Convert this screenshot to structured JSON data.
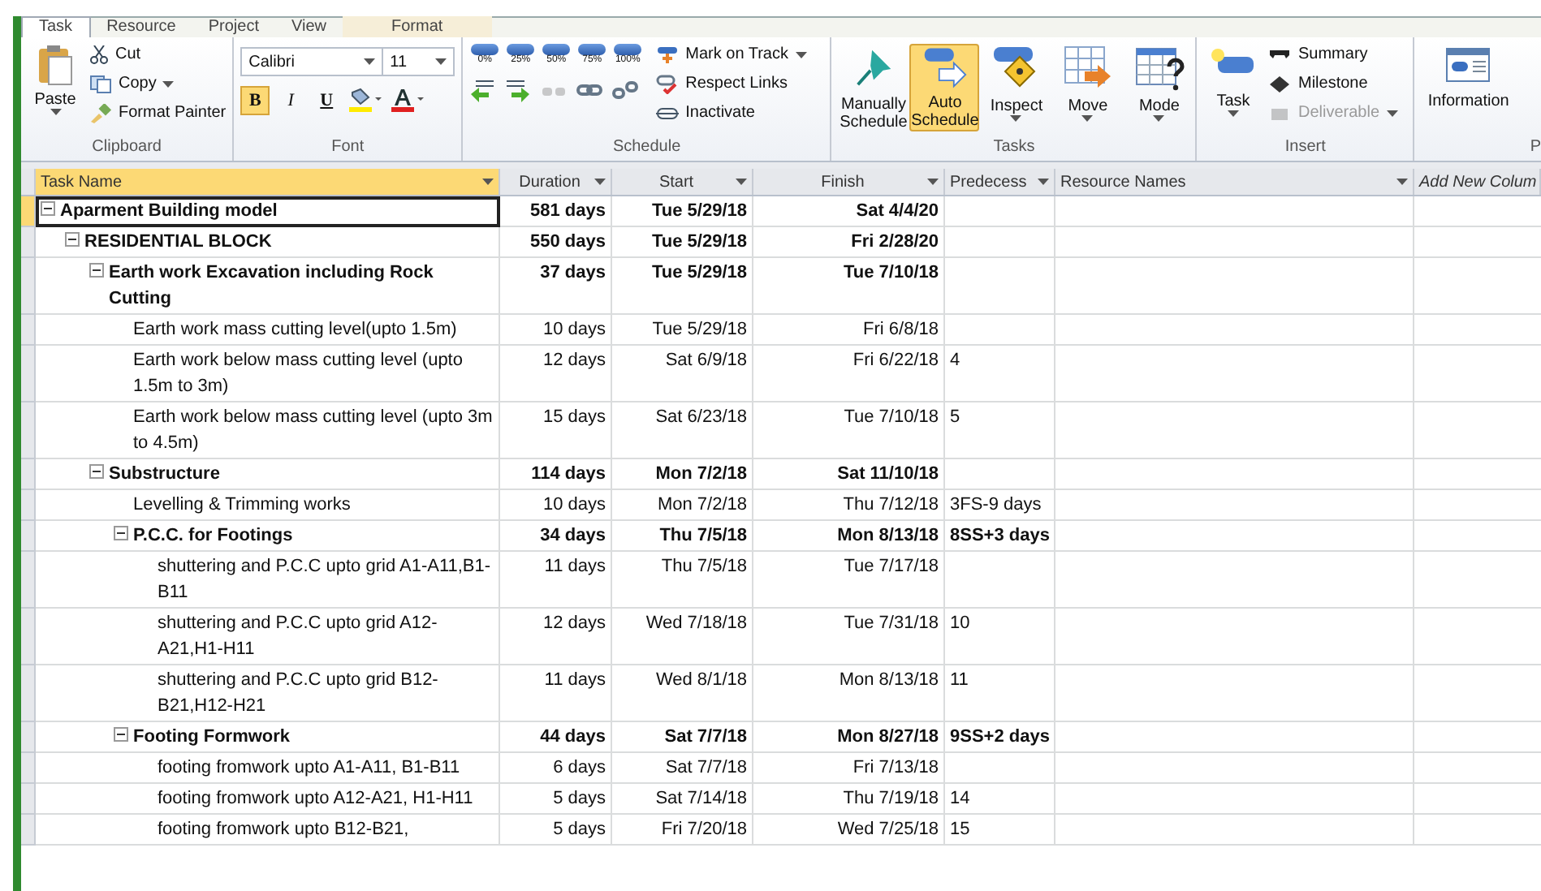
{
  "tabs": [
    {
      "label": "Task",
      "selected": true
    },
    {
      "label": "Resource",
      "selected": false
    },
    {
      "label": "Project",
      "selected": false
    },
    {
      "label": "View",
      "selected": false
    },
    {
      "label": "Format",
      "selected": false
    }
  ],
  "clipboard": {
    "paste": "Paste",
    "cut": "Cut",
    "copy": "Copy",
    "format_painter": "Format Painter",
    "label": "Clipboard"
  },
  "font": {
    "name": "Calibri",
    "size": "11",
    "styles": [
      {
        "label": "B",
        "selected": true
      },
      {
        "label": "I",
        "selected": false
      },
      {
        "label": "U",
        "selected": false
      }
    ],
    "label": "Font"
  },
  "schedule": {
    "percent_buttons": [
      "0%",
      "25%",
      "50%",
      "75%",
      "100%"
    ],
    "actions": [
      "Mark on Track",
      "Respect Links",
      "Inactivate"
    ],
    "label": "Schedule"
  },
  "tasks": {
    "buttons": [
      {
        "label": "Manually Schedule",
        "kind": "pin",
        "selected": false
      },
      {
        "label": "Auto Schedule",
        "kind": "auto",
        "selected": true
      },
      {
        "label": "Inspect",
        "kind": "inspect",
        "selected": false
      },
      {
        "label": "Move",
        "kind": "move",
        "selected": false
      },
      {
        "label": "Mode",
        "kind": "mode",
        "selected": false
      }
    ],
    "label": "Tasks"
  },
  "insert": {
    "task": "Task",
    "items": [
      {
        "label": "Summary",
        "disabled": false
      },
      {
        "label": "Milestone",
        "disabled": false
      },
      {
        "label": "Deliverable",
        "disabled": true
      }
    ],
    "label": "Insert"
  },
  "properties": {
    "information": "Information",
    "label": "P"
  },
  "table": {
    "columns": [
      "Task Name",
      "Duration",
      "Start",
      "Finish",
      "Predecess",
      "Resource Names",
      "Add New Colum"
    ],
    "rows": [
      {
        "name": "Aparment Building model",
        "duration": "581 days",
        "start": "Tue 5/29/18",
        "finish": "Sat 4/4/20",
        "selected": true,
        "expanded": true,
        "children": [
          {
            "name": "RESIDENTIAL BLOCK",
            "duration": "550 days",
            "start": "Tue 5/29/18",
            "finish": "Fri 2/28/20",
            "selected": false,
            "expanded": true,
            "children": [
              {
                "name": "Earth work Excavation including Rock Cutting",
                "duration": "37 days",
                "start": "Tue 5/29/18",
                "finish": "Tue 7/10/18",
                "selected": false,
                "expanded": true,
                "children": [
                  {
                    "name": "Earth work mass cutting level(upto 1.5m)",
                    "duration": "10 days",
                    "start": "Tue 5/29/18",
                    "finish": "Fri 6/8/18",
                    "selected": false
                  },
                  {
                    "name": "Earth work below mass cutting level (upto 1.5m to 3m)",
                    "duration": "12 days",
                    "start": "Sat 6/9/18",
                    "finish": "Fri 6/22/18",
                    "predecessors": "4",
                    "selected": false
                  },
                  {
                    "name": "Earth work below mass cutting level (upto 3m to 4.5m)",
                    "duration": "15 days",
                    "start": "Sat 6/23/18",
                    "finish": "Tue 7/10/18",
                    "predecessors": "5",
                    "selected": false
                  }
                ]
              },
              {
                "name": "Substructure",
                "duration": "114 days",
                "start": "Mon 7/2/18",
                "finish": "Sat 11/10/18",
                "selected": false,
                "expanded": true,
                "children": [
                  {
                    "name": "Levelling & Trimming works",
                    "duration": "10 days",
                    "start": "Mon 7/2/18",
                    "finish": "Thu 7/12/18",
                    "predecessors": "3FS-9 days",
                    "selected": false
                  },
                  {
                    "name": "P.C.C. for Footings",
                    "duration": "34 days",
                    "start": "Thu 7/5/18",
                    "finish": "Mon 8/13/18",
                    "predecessors": "8SS+3 days",
                    "selected": false,
                    "expanded": true,
                    "children": [
                      {
                        "name": "shuttering and P.C.C upto grid A1-A11,B1-B11",
                        "duration": "11 days",
                        "start": "Thu 7/5/18",
                        "finish": "Tue 7/17/18",
                        "selected": false
                      },
                      {
                        "name": "shuttering and P.C.C upto grid A12-A21,H1-H11",
                        "duration": "12 days",
                        "start": "Wed 7/18/18",
                        "finish": "Tue 7/31/18",
                        "predecessors": "10",
                        "selected": false
                      },
                      {
                        "name": "shuttering and P.C.C upto grid B12-B21,H12-H21",
                        "duration": "11 days",
                        "start": "Wed 8/1/18",
                        "finish": "Mon 8/13/18",
                        "predecessors": "11",
                        "selected": false
                      }
                    ]
                  },
                  {
                    "name": "Footing Formwork",
                    "duration": "44 days",
                    "start": "Sat 7/7/18",
                    "finish": "Mon 8/27/18",
                    "predecessors": "9SS+2 days",
                    "selected": false,
                    "expanded": true,
                    "children": [
                      {
                        "name": "footing fromwork upto A1-A11, B1-B11",
                        "duration": "6 days",
                        "start": "Sat 7/7/18",
                        "finish": "Fri 7/13/18",
                        "selected": false
                      },
                      {
                        "name": "footing fromwork upto A12-A21, H1-H11",
                        "duration": "5 days",
                        "start": "Sat 7/14/18",
                        "finish": "Thu 7/19/18",
                        "predecessors": "14",
                        "selected": false
                      },
                      {
                        "name": "footing fromwork upto B12-B21,",
                        "duration": "5 days",
                        "start": "Fri 7/20/18",
                        "finish": "Wed 7/25/18",
                        "predecessors": "15",
                        "selected": false
                      }
                    ]
                  }
                ]
              }
            ]
          }
        ]
      }
    ]
  }
}
